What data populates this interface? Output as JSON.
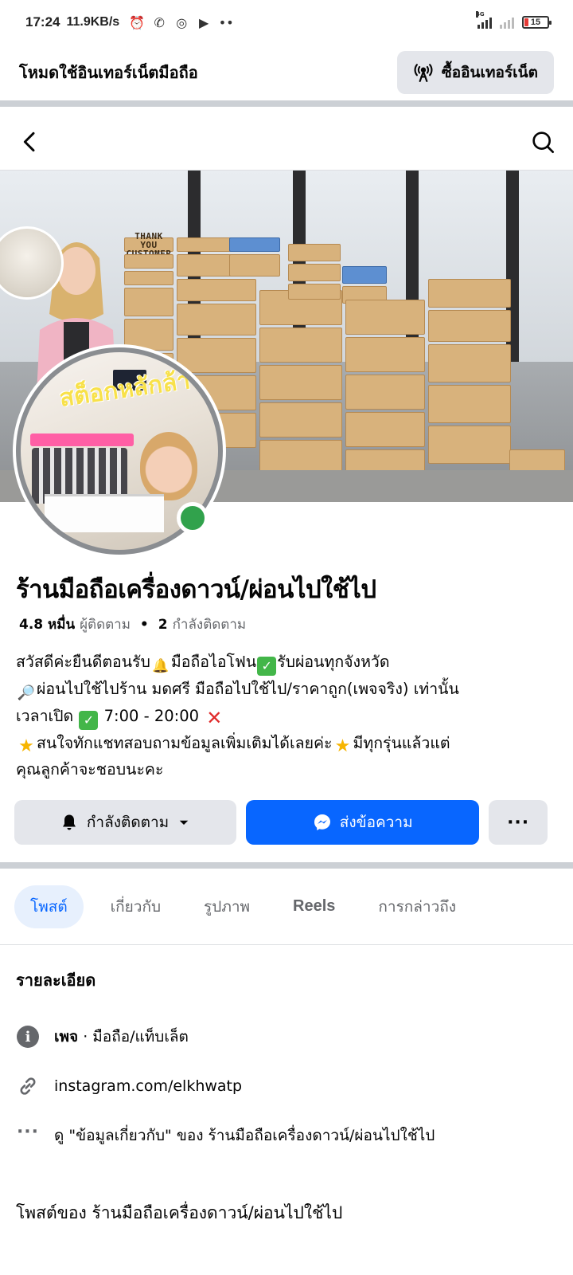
{
  "status_bar": {
    "time": "17:24",
    "net_speed": "11.9KB/s",
    "network_type": "4G",
    "battery_level": "15"
  },
  "data_banner": {
    "title": "โหมดใช้อินเทอร์เน็ตมือถือ",
    "buy_label": "ซื้ออินเทอร์เน็ต"
  },
  "cover": {
    "box_text": "THANK YOU CUSTOMER",
    "avatar_overlay": "สต็อกหลักล้าน"
  },
  "page": {
    "name": "ร้านมือถือเครื่องดาวน์/ผ่อนไปใช้ไป",
    "followers_count": "4.8 หมื่น",
    "followers_label": "ผู้ติดตาม",
    "following_count": "2",
    "following_label": "กำลังติดตาม",
    "online": true
  },
  "bio": {
    "line1_a": "สวัสดีค่ะยืนดีตอนรับ",
    "line1_b": "มือถือไอโฟน",
    "line1_c": "รับผ่อนทุกจังหวัด",
    "line2": "ผ่อนไปใช้ไปร้าน มดศรี มือถือไปใช้ไป/ราคาถูก(เพจจริง)   เท่านั้น",
    "line3_a": "เวลาเปิด",
    "line3_b": "7:00 - 20:00",
    "line4_a": "สนใจทักแชทสอบถามข้อมูลเพิ่มเติมได้เลยค่ะ",
    "line4_b": "มีทุกรุ่นแล้วแต่",
    "line5": "คุณลูกค้าจะชอบนะคะ"
  },
  "actions": {
    "following_label": "กำลังติดตาม",
    "message_label": "ส่งข้อความ",
    "more_label": "···"
  },
  "tabs": [
    {
      "label": "โพสต์",
      "active": true
    },
    {
      "label": "เกี่ยวกับ",
      "active": false
    },
    {
      "label": "รูปภาพ",
      "active": false
    },
    {
      "label": "Reels",
      "active": false
    },
    {
      "label": "การกล่าวถึง",
      "active": false
    }
  ],
  "details": {
    "title": "รายละเอียด",
    "category_prefix": "เพจ",
    "category_sep": " · ",
    "category": "มือถือ/แท็บเล็ต",
    "link": "instagram.com/elkhwatp",
    "see_about": "ดู \"ข้อมูลเกี่ยวกับ\" ของ ร้านมือถือเครื่องดาวน์/ผ่อนไปใช้ไป"
  },
  "posts_title": "โพสต์ของ ร้านมือถือเครื่องดาวน์/ผ่อนไปใช้ไป",
  "colors": {
    "primary_blue": "#0866ff",
    "online_green": "#31a24c",
    "button_gray": "#e4e6eb",
    "muted_text": "#65676b"
  },
  "icons": {
    "back": "chevron-left-icon",
    "search": "search-icon",
    "antenna": "antenna-icon",
    "bell": "bell-icon",
    "messenger": "messenger-icon",
    "info": "info-icon",
    "link": "link-icon",
    "more": "more-dots-icon"
  }
}
